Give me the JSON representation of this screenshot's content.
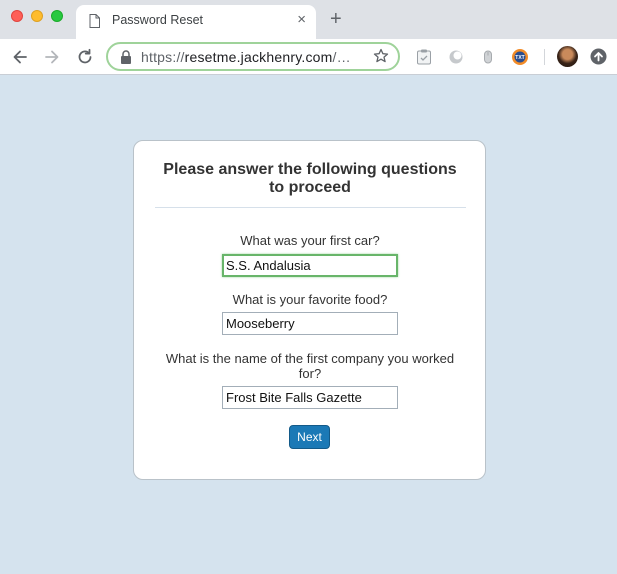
{
  "browser": {
    "tab": {
      "title": "Password Reset",
      "close_label": "×",
      "icon": "document-icon"
    },
    "new_tab_label": "+",
    "address_bar": {
      "scheme": "https://",
      "host": "resetme.jackhenry.com",
      "rest": "/…",
      "secure": true
    },
    "extensions": [
      "clipboard-extension-icon",
      "circle-extension-icon",
      "mouse-extension-icon",
      "txt-extension-icon"
    ],
    "colors": {
      "tabbar": "#dee1e6",
      "omnibox_focus": "#9fd39a"
    }
  },
  "page": {
    "background": "#d5e3ee",
    "title": "Please answer the following questions to proceed",
    "questions": [
      {
        "label": "What was your first car?",
        "answer": "S.S. Andalusia"
      },
      {
        "label": "What is your favorite food?",
        "answer": "Mooseberry"
      },
      {
        "label": "What is the name of the first company you worked for?",
        "answer": "Frost Bite Falls Gazette"
      }
    ],
    "next_label": "Next",
    "accent": "#1b79b6",
    "focus_color": "#68b56a"
  }
}
